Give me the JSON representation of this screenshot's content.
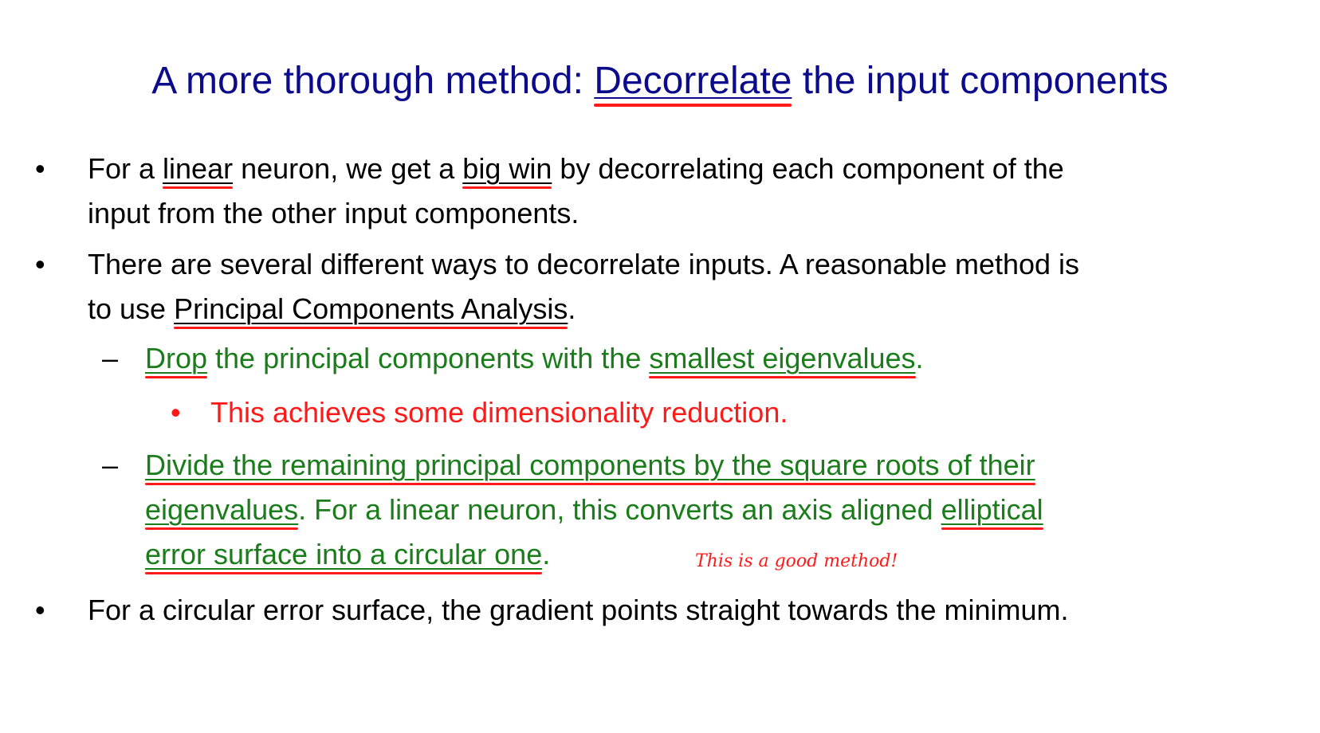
{
  "title": {
    "before": "A more thorough method: ",
    "underlined": "Decorrelate",
    "after": " the input components"
  },
  "bullets": {
    "b1": {
      "marker": "•",
      "l1_a": "For a ",
      "l1_u1": "linear",
      "l1_b": "  neuron, we get a ",
      "l1_u2": "big win",
      "l1_c": " by decorrelating each component of the",
      "l2": "input from the other input components."
    },
    "b2": {
      "marker": "•",
      "l1": "There are several different ways to decorrelate inputs. A reasonable method is",
      "l2_a": "to use ",
      "l2_u": "Principal Components Analysis",
      "l2_b": "."
    },
    "s1": {
      "marker": "–",
      "u1": "Drop",
      "mid": " the principal components with the ",
      "u2": "smallest eigenvalues",
      "end": "."
    },
    "ss1": {
      "marker": "•",
      "text": "This achieves some dimensionality reduction."
    },
    "s2": {
      "marker": "–",
      "l1_u": "Divide the remaining principal components by the square roots of their",
      "l2_u": "eigenvalues",
      "l2_mid": ". For a linear neuron,  this  converts an axis aligned ",
      "l2_u2": "elliptical",
      "l3_u": "error surface into a circular one",
      "l3_end": "."
    },
    "b3": {
      "marker": "•",
      "text": "For a circular error surface, the gradient points straight towards the minimum."
    }
  },
  "annotation": "This is a good method!",
  "colors": {
    "title": "#0b0b8c",
    "body": "#000000",
    "green": "#1a7c1a",
    "red": "#ff1a1a"
  }
}
